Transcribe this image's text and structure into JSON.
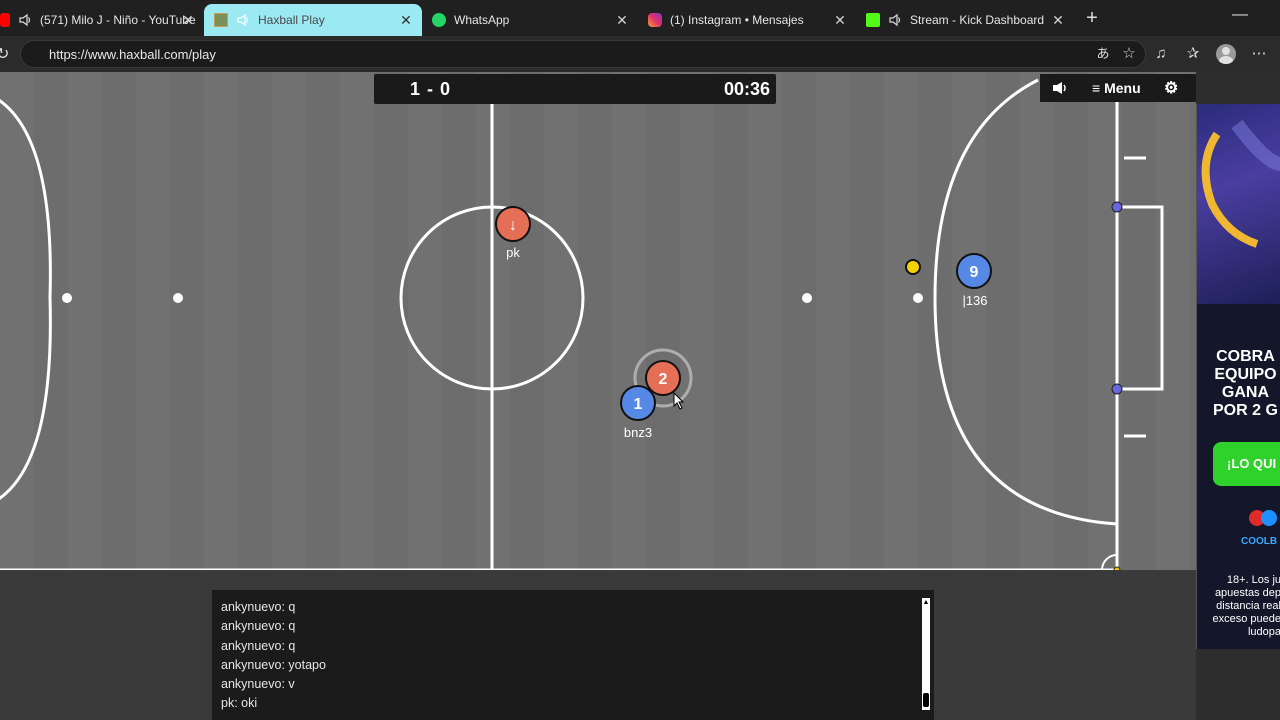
{
  "browser": {
    "tabs": [
      {
        "title": "(571) Milo J - Niño - YouTube",
        "favicon": "youtube-icon",
        "audio": true,
        "active": false
      },
      {
        "title": "Haxball Play",
        "favicon": "haxball-icon",
        "audio": true,
        "active": true
      },
      {
        "title": "WhatsApp",
        "favicon": "whatsapp-icon",
        "audio": false,
        "active": false
      },
      {
        "title": "(1) Instagram • Mensajes",
        "favicon": "instagram-icon",
        "audio": false,
        "active": false
      },
      {
        "title": "Stream - Kick Dashboard",
        "favicon": "kick-icon",
        "audio": true,
        "active": false
      }
    ],
    "close_glyph": "✕",
    "new_tab_glyph": "+",
    "minimize_glyph": "—",
    "reload_glyph": "↻",
    "url": "https://www.haxball.com/play",
    "toolbar_icons": [
      "translate-icon",
      "favorite-star-icon",
      "music-icon",
      "favorites-icon",
      "profile-avatar",
      "more-icon"
    ]
  },
  "game": {
    "score": "1 - 0",
    "timer": "00:36",
    "menu_label": "Menu",
    "menu_glyph": "≡",
    "gear_glyph": "⚙",
    "colors": {
      "pitch": "#6e6e6e",
      "red_team": "#e56e56",
      "blue_team": "#5689e5",
      "ball": "#ffff00",
      "goal_post": "#8888ff"
    },
    "players": [
      {
        "team": "red",
        "avatar": "↓",
        "name": "pk"
      },
      {
        "team": "red",
        "avatar": "2",
        "name": ""
      },
      {
        "team": "blue",
        "avatar": "1",
        "name": "bnz3"
      },
      {
        "team": "blue",
        "avatar": "9",
        "name": "|136"
      }
    ]
  },
  "chat": {
    "messages": [
      "ankynuevo: q",
      "ankynuevo: q",
      "ankynuevo: q",
      "ankynuevo: yotapo",
      "ankynuevo: v",
      "pk: oki"
    ]
  },
  "ad": {
    "headline": "COBRA\nEQUIPO\nGANA\nPOR 2 G",
    "cta": "¡LO QUI",
    "brand": "COOLB",
    "disclaimer": "18+. Los ju\napuestas dep\ndistancia real\nexceso puede\nludopa"
  }
}
